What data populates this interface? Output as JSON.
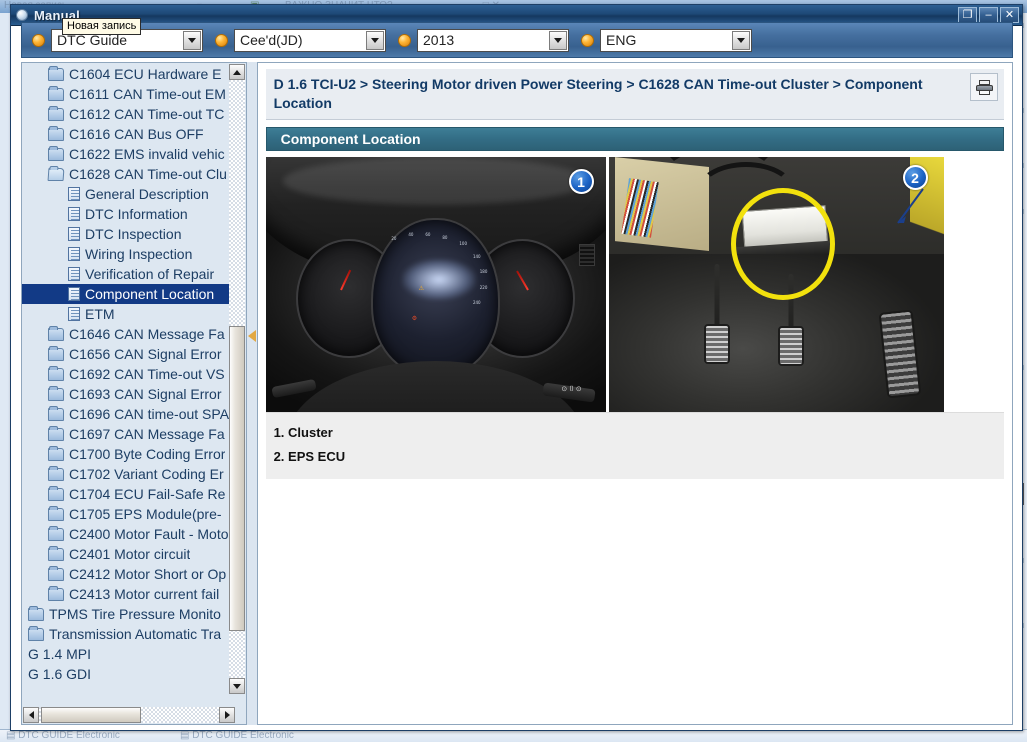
{
  "window": {
    "title": "Manual",
    "tooltip": "Новая запись",
    "buttons": {
      "restore": "❐",
      "minimize": "–",
      "close": "✕"
    }
  },
  "toolbar": {
    "selectors": [
      {
        "name": "guide",
        "value": "DTC Guide"
      },
      {
        "name": "model",
        "value": "Cee'd(JD)"
      },
      {
        "name": "year",
        "value": "2013"
      },
      {
        "name": "language",
        "value": "ENG"
      }
    ]
  },
  "tree": {
    "items": [
      {
        "label": "C1604 ECU Hardware E",
        "icon": "folder-icon",
        "indent": 1,
        "selected": false
      },
      {
        "label": "C1611 CAN Time-out EM",
        "icon": "folder-icon",
        "indent": 1,
        "selected": false
      },
      {
        "label": "C1612 CAN Time-out TC",
        "icon": "folder-icon",
        "indent": 1,
        "selected": false
      },
      {
        "label": "C1616 CAN Bus OFF",
        "icon": "folder-icon",
        "indent": 1,
        "selected": false
      },
      {
        "label": "C1622 EMS invalid vehic",
        "icon": "folder-icon",
        "indent": 1,
        "selected": false
      },
      {
        "label": "C1628 CAN Time-out Clu",
        "icon": "folder-open-icon",
        "indent": 1,
        "selected": false
      },
      {
        "label": "General Description",
        "icon": "document-icon",
        "indent": 2,
        "selected": false
      },
      {
        "label": "DTC Information",
        "icon": "document-icon",
        "indent": 2,
        "selected": false
      },
      {
        "label": "DTC Inspection",
        "icon": "document-icon",
        "indent": 2,
        "selected": false
      },
      {
        "label": "Wiring Inspection",
        "icon": "document-icon",
        "indent": 2,
        "selected": false
      },
      {
        "label": "Verification of Repair",
        "icon": "document-icon",
        "indent": 2,
        "selected": false
      },
      {
        "label": "Component Location",
        "icon": "document-icon",
        "indent": 2,
        "selected": true
      },
      {
        "label": "ETM",
        "icon": "document-icon",
        "indent": 2,
        "selected": false
      },
      {
        "label": "C1646 CAN Message Fa",
        "icon": "folder-icon",
        "indent": 1,
        "selected": false
      },
      {
        "label": "C1656 CAN Signal Error",
        "icon": "folder-icon",
        "indent": 1,
        "selected": false
      },
      {
        "label": "C1692 CAN Time-out VS",
        "icon": "folder-icon",
        "indent": 1,
        "selected": false
      },
      {
        "label": "C1693 CAN Signal Error",
        "icon": "folder-icon",
        "indent": 1,
        "selected": false
      },
      {
        "label": "C1696 CAN time-out SPA",
        "icon": "folder-icon",
        "indent": 1,
        "selected": false
      },
      {
        "label": "C1697 CAN Message Fa",
        "icon": "folder-icon",
        "indent": 1,
        "selected": false
      },
      {
        "label": "C1700 Byte Coding Error",
        "icon": "folder-icon",
        "indent": 1,
        "selected": false
      },
      {
        "label": "C1702 Variant Coding Er",
        "icon": "folder-icon",
        "indent": 1,
        "selected": false
      },
      {
        "label": "C1704 ECU Fail-Safe Re",
        "icon": "folder-icon",
        "indent": 1,
        "selected": false
      },
      {
        "label": "C1705 EPS Module(pre-",
        "icon": "folder-icon",
        "indent": 1,
        "selected": false
      },
      {
        "label": "C2400 Motor Fault - Moto",
        "icon": "folder-icon",
        "indent": 1,
        "selected": false
      },
      {
        "label": "C2401 Motor circuit",
        "icon": "folder-icon",
        "indent": 1,
        "selected": false
      },
      {
        "label": "C2412 Motor Short or Op",
        "icon": "folder-icon",
        "indent": 1,
        "selected": false
      },
      {
        "label": "C2413 Motor current fail",
        "icon": "folder-icon",
        "indent": 1,
        "selected": false
      },
      {
        "label": "TPMS Tire Pressure Monito",
        "icon": "folder-icon",
        "indent": 0,
        "selected": false
      },
      {
        "label": "Transmission Automatic Tra",
        "icon": "folder-icon",
        "indent": 0,
        "selected": false
      },
      {
        "label": "G 1.4 MPI",
        "icon": "none",
        "indent": 0,
        "selected": false
      },
      {
        "label": "G 1.6 GDI",
        "icon": "none",
        "indent": 0,
        "selected": false
      }
    ]
  },
  "content": {
    "breadcrumb": "D 1.6 TCI-U2 > Steering Motor driven Power Steering > C1628 CAN Time-out Cluster > Component Location",
    "section_title": "Component Location",
    "print_icon": "printer-icon",
    "figures": [
      {
        "callout": "1",
        "alt": "Instrument cluster photo"
      },
      {
        "callout": "2",
        "alt": "EPS ECU in driver footwell photo"
      }
    ],
    "captions": [
      "1. Cluster",
      "2. EPS ECU"
    ]
  },
  "colors": {
    "title_bar": "#1d4876",
    "toolbar": "#456f9f",
    "selection": "#123a86",
    "section_header": "#336d85",
    "callout": "#1b62c4",
    "highlight_circle": "#f2e10d",
    "tree_text": "#1d3e64"
  }
}
